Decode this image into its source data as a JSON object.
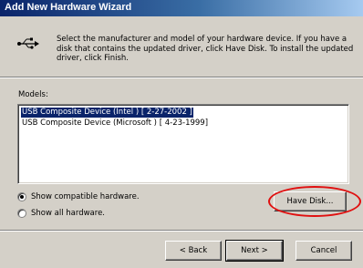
{
  "window": {
    "title": "Add New Hardware Wizard"
  },
  "header": {
    "icon": "usb-icon",
    "description": "Select the manufacturer and model of your hardware device. If you have a disk that contains the updated driver, click Have Disk. To install the updated driver, click Finish."
  },
  "models": {
    "label": "Models:",
    "items": [
      {
        "text": "USB Composite Device (Intel ) [ 2-27-2002 ]",
        "selected": true
      },
      {
        "text": "USB Composite Device (Microsoft ) [ 4-23-1999]",
        "selected": false
      }
    ]
  },
  "options": {
    "show_compatible": "Show compatible hardware.",
    "show_all": "Show all hardware.",
    "selected": "show_compatible"
  },
  "buttons": {
    "have_disk": "Have Disk...",
    "back": "< Back",
    "next": "Next >",
    "cancel": "Cancel"
  },
  "annotation": {
    "highlight_color": "#e01010"
  }
}
